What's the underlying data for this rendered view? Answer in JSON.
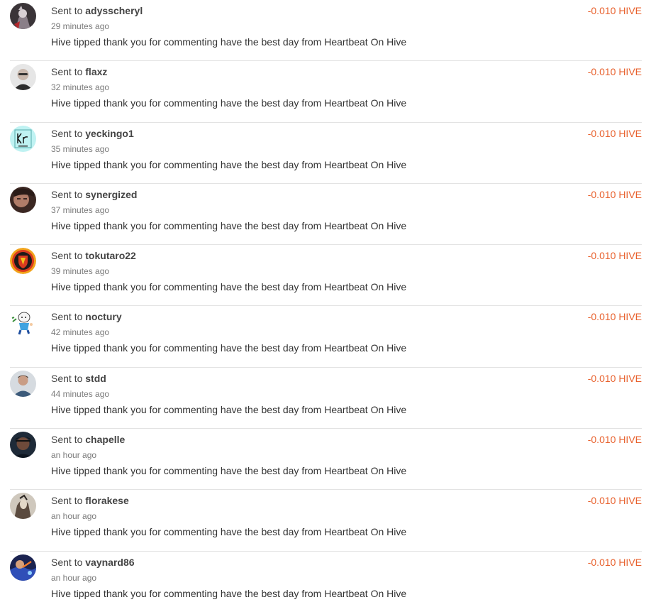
{
  "transfers": [
    {
      "prefix": "Sent to",
      "user": "adysscheryl",
      "time": "29 minutes ago",
      "memo": "Hive tipped thank you for commenting have the best day from Heartbeat On Hive",
      "amount": "-0.010 HIVE",
      "avatar_icon": "user-avatar-icon"
    },
    {
      "prefix": "Sent to",
      "user": "flaxz",
      "time": "32 minutes ago",
      "memo": "Hive tipped thank you for commenting have the best day from Heartbeat On Hive",
      "amount": "-0.010 HIVE",
      "avatar_icon": "user-avatar-icon"
    },
    {
      "prefix": "Sent to",
      "user": "yeckingo1",
      "time": "35 minutes ago",
      "memo": "Hive tipped thank you for commenting have the best day from Heartbeat On Hive",
      "amount": "-0.010 HIVE",
      "avatar_icon": "krypton-element-avatar-icon"
    },
    {
      "prefix": "Sent to",
      "user": "synergized",
      "time": "37 minutes ago",
      "memo": "Hive tipped thank you for commenting have the best day from Heartbeat On Hive",
      "amount": "-0.010 HIVE",
      "avatar_icon": "user-avatar-icon"
    },
    {
      "prefix": "Sent to",
      "user": "tokutaro22",
      "time": "39 minutes ago",
      "memo": "Hive tipped thank you for commenting have the best day from Heartbeat On Hive",
      "amount": "-0.010 HIVE",
      "avatar_icon": "shield-emblem-avatar-icon"
    },
    {
      "prefix": "Sent to",
      "user": "noctury",
      "time": "42 minutes ago",
      "memo": "Hive tipped thank you for commenting have the best day from Heartbeat On Hive",
      "amount": "-0.010 HIVE",
      "avatar_icon": "cartoon-avatar-icon"
    },
    {
      "prefix": "Sent to",
      "user": "stdd",
      "time": "44 minutes ago",
      "memo": "Hive tipped thank you for commenting have the best day from Heartbeat On Hive",
      "amount": "-0.010 HIVE",
      "avatar_icon": "user-avatar-icon"
    },
    {
      "prefix": "Sent to",
      "user": "chapelle",
      "time": "an hour ago",
      "memo": "Hive tipped thank you for commenting have the best day from Heartbeat On Hive",
      "amount": "-0.010 HIVE",
      "avatar_icon": "user-avatar-icon"
    },
    {
      "prefix": "Sent to",
      "user": "florakese",
      "time": "an hour ago",
      "memo": "Hive tipped thank you for commenting have the best day from Heartbeat On Hive",
      "amount": "-0.010 HIVE",
      "avatar_icon": "user-avatar-icon"
    },
    {
      "prefix": "Sent to",
      "user": "vaynard86",
      "time": "an hour ago",
      "memo": "Hive tipped thank you for commenting have the best day from Heartbeat On Hive",
      "amount": "-0.010 HIVE",
      "avatar_icon": "user-avatar-icon"
    }
  ],
  "colors": {
    "amount_negative": "#e8602c",
    "divider": "#e3e3e3",
    "text": "#444444",
    "muted": "#7a7a7a"
  }
}
